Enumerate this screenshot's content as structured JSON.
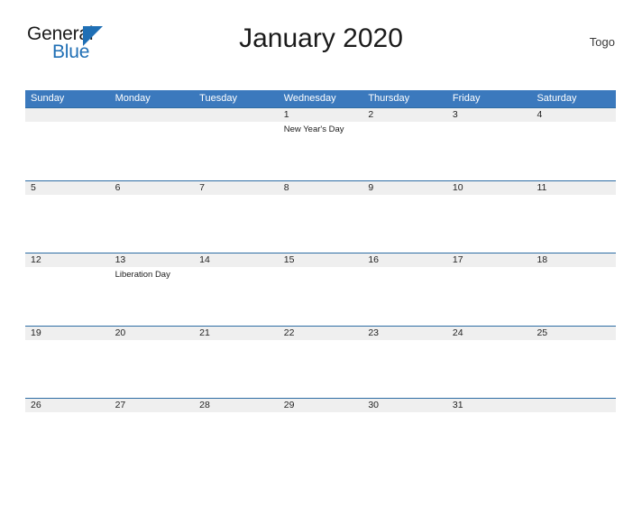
{
  "logo": {
    "part1": "General",
    "part2": "Blue",
    "triangle_color": "#1f6fb5",
    "icon": "triangle-icon"
  },
  "header": {
    "title": "January 2020",
    "region": "Togo"
  },
  "colors": {
    "header_blue": "#3b79bd",
    "rule_blue": "#2e6da4",
    "band_gray": "#efefef",
    "text_dark": "#1b1b1b"
  },
  "calendar": {
    "weekdays": [
      "Sunday",
      "Monday",
      "Tuesday",
      "Wednesday",
      "Thursday",
      "Friday",
      "Saturday"
    ],
    "weeks": [
      {
        "days": [
          {
            "date": "",
            "event": ""
          },
          {
            "date": "",
            "event": ""
          },
          {
            "date": "",
            "event": ""
          },
          {
            "date": "1",
            "event": "New Year's Day"
          },
          {
            "date": "2",
            "event": ""
          },
          {
            "date": "3",
            "event": ""
          },
          {
            "date": "4",
            "event": ""
          }
        ]
      },
      {
        "days": [
          {
            "date": "5",
            "event": ""
          },
          {
            "date": "6",
            "event": ""
          },
          {
            "date": "7",
            "event": ""
          },
          {
            "date": "8",
            "event": ""
          },
          {
            "date": "9",
            "event": ""
          },
          {
            "date": "10",
            "event": ""
          },
          {
            "date": "11",
            "event": ""
          }
        ]
      },
      {
        "days": [
          {
            "date": "12",
            "event": ""
          },
          {
            "date": "13",
            "event": "Liberation Day"
          },
          {
            "date": "14",
            "event": ""
          },
          {
            "date": "15",
            "event": ""
          },
          {
            "date": "16",
            "event": ""
          },
          {
            "date": "17",
            "event": ""
          },
          {
            "date": "18",
            "event": ""
          }
        ]
      },
      {
        "days": [
          {
            "date": "19",
            "event": ""
          },
          {
            "date": "20",
            "event": ""
          },
          {
            "date": "21",
            "event": ""
          },
          {
            "date": "22",
            "event": ""
          },
          {
            "date": "23",
            "event": ""
          },
          {
            "date": "24",
            "event": ""
          },
          {
            "date": "25",
            "event": ""
          }
        ]
      },
      {
        "days": [
          {
            "date": "26",
            "event": ""
          },
          {
            "date": "27",
            "event": ""
          },
          {
            "date": "28",
            "event": ""
          },
          {
            "date": "29",
            "event": ""
          },
          {
            "date": "30",
            "event": ""
          },
          {
            "date": "31",
            "event": ""
          },
          {
            "date": "",
            "event": ""
          }
        ]
      }
    ]
  }
}
